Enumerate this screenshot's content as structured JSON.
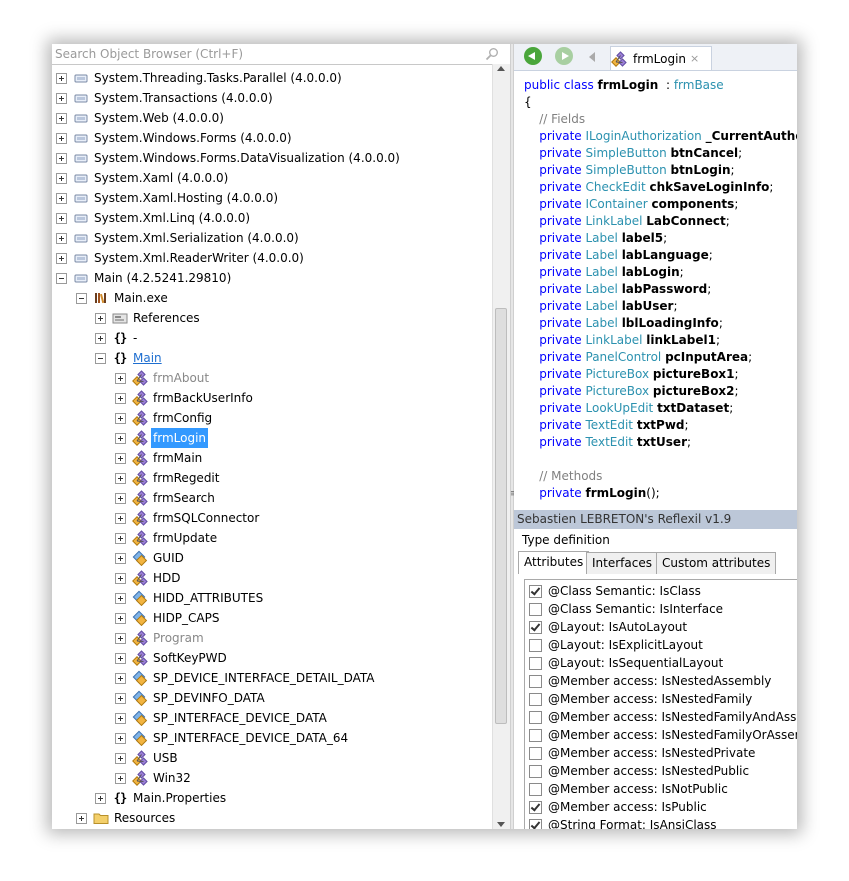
{
  "search": {
    "placeholder": "Search Object Browser (Ctrl+F)"
  },
  "tree": {
    "items": [
      {
        "label": "System.Threading.Tasks.Parallel (4.0.0.0)",
        "icon": "assembly-icon",
        "expander": "plus",
        "level": 0
      },
      {
        "label": "System.Transactions (4.0.0.0)",
        "icon": "assembly-icon",
        "expander": "plus",
        "level": 0
      },
      {
        "label": "System.Web (4.0.0.0)",
        "icon": "assembly-icon",
        "expander": "plus",
        "level": 0
      },
      {
        "label": "System.Windows.Forms (4.0.0.0)",
        "icon": "assembly-icon",
        "expander": "plus",
        "level": 0
      },
      {
        "label": "System.Windows.Forms.DataVisualization (4.0.0.0)",
        "icon": "assembly-icon",
        "expander": "plus",
        "level": 0
      },
      {
        "label": "System.Xaml (4.0.0.0)",
        "icon": "assembly-icon",
        "expander": "plus",
        "level": 0
      },
      {
        "label": "System.Xaml.Hosting (4.0.0.0)",
        "icon": "assembly-icon",
        "expander": "plus",
        "level": 0
      },
      {
        "label": "System.Xml.Linq (4.0.0.0)",
        "icon": "assembly-icon",
        "expander": "plus",
        "level": 0
      },
      {
        "label": "System.Xml.Serialization (4.0.0.0)",
        "icon": "assembly-icon",
        "expander": "plus",
        "level": 0
      },
      {
        "label": "System.Xml.ReaderWriter (4.0.0.0)",
        "icon": "assembly-icon",
        "expander": "plus",
        "level": 0
      },
      {
        "label": "Main (4.2.5241.29810)",
        "icon": "assembly-icon",
        "expander": "minus",
        "level": 0
      },
      {
        "label": "Main.exe",
        "icon": "module-icon",
        "expander": "minus",
        "level": 1
      },
      {
        "label": "References",
        "icon": "references-icon",
        "expander": "plus",
        "level": 2
      },
      {
        "label": "-",
        "icon": "namespace-icon",
        "expander": "plus",
        "level": 2
      },
      {
        "label": "Main",
        "icon": "namespace-icon",
        "expander": "minus",
        "level": 2,
        "style": "link"
      },
      {
        "label": "frmAbout",
        "icon": "class-icon",
        "expander": "plus",
        "level": 3,
        "style": "gray"
      },
      {
        "label": "frmBackUserInfo",
        "icon": "class-icon",
        "expander": "plus",
        "level": 3
      },
      {
        "label": "frmConfig",
        "icon": "class-icon",
        "expander": "plus",
        "level": 3
      },
      {
        "label": "frmLogin",
        "icon": "class-icon",
        "expander": "plus",
        "level": 3,
        "style": "selected"
      },
      {
        "label": "frmMain",
        "icon": "class-icon",
        "expander": "plus",
        "level": 3
      },
      {
        "label": "frmRegedit",
        "icon": "class-icon",
        "expander": "plus",
        "level": 3
      },
      {
        "label": "frmSearch",
        "icon": "class-icon",
        "expander": "plus",
        "level": 3
      },
      {
        "label": "frmSQLConnector",
        "icon": "class-icon",
        "expander": "plus",
        "level": 3
      },
      {
        "label": "frmUpdate",
        "icon": "class-icon",
        "expander": "plus",
        "level": 3
      },
      {
        "label": "GUID",
        "icon": "struct-icon",
        "expander": "plus",
        "level": 3
      },
      {
        "label": "HDD",
        "icon": "class-icon",
        "expander": "plus",
        "level": 3
      },
      {
        "label": "HIDD_ATTRIBUTES",
        "icon": "struct-icon",
        "expander": "plus",
        "level": 3
      },
      {
        "label": "HIDP_CAPS",
        "icon": "struct-icon",
        "expander": "plus",
        "level": 3
      },
      {
        "label": "Program",
        "icon": "class-icon",
        "expander": "plus",
        "level": 3,
        "style": "gray"
      },
      {
        "label": "SoftKeyPWD",
        "icon": "class-icon",
        "expander": "plus",
        "level": 3
      },
      {
        "label": "SP_DEVICE_INTERFACE_DETAIL_DATA",
        "icon": "struct-icon",
        "expander": "plus",
        "level": 3
      },
      {
        "label": "SP_DEVINFO_DATA",
        "icon": "struct-icon",
        "expander": "plus",
        "level": 3
      },
      {
        "label": "SP_INTERFACE_DEVICE_DATA",
        "icon": "struct-icon",
        "expander": "plus",
        "level": 3
      },
      {
        "label": "SP_INTERFACE_DEVICE_DATA_64",
        "icon": "struct-icon",
        "expander": "plus",
        "level": 3
      },
      {
        "label": "USB",
        "icon": "class-icon",
        "expander": "plus",
        "level": 3
      },
      {
        "label": "Win32",
        "icon": "class-icon",
        "expander": "plus",
        "level": 3
      },
      {
        "label": "Main.Properties",
        "icon": "namespace-icon",
        "expander": "plus",
        "level": 2
      },
      {
        "label": "Resources",
        "icon": "folder-icon",
        "expander": "plus",
        "level": 1
      }
    ]
  },
  "editor": {
    "tab_title": "frmLogin",
    "tab_close": "×",
    "code": [
      [
        [
          "kw",
          "public class "
        ],
        [
          "b",
          "frmLogin"
        ],
        [
          "",
          "  : "
        ],
        [
          "ty",
          "frmBase"
        ]
      ],
      [
        [
          "",
          "{"
        ]
      ],
      [
        [
          "cm",
          "    // Fields"
        ]
      ],
      [
        [
          "kw",
          "    private "
        ],
        [
          "ty",
          "ILoginAuthorization "
        ],
        [
          "b",
          "_CurrentAuthorization"
        ]
      ],
      [
        [
          "kw",
          "    private "
        ],
        [
          "ty",
          "SimpleButton "
        ],
        [
          "b",
          "btnCancel"
        ],
        [
          "",
          ";"
        ]
      ],
      [
        [
          "kw",
          "    private "
        ],
        [
          "ty",
          "SimpleButton "
        ],
        [
          "b",
          "btnLogin"
        ],
        [
          "",
          ";"
        ]
      ],
      [
        [
          "kw",
          "    private "
        ],
        [
          "ty",
          "CheckEdit "
        ],
        [
          "b",
          "chkSaveLoginInfo"
        ],
        [
          "",
          ";"
        ]
      ],
      [
        [
          "kw",
          "    private "
        ],
        [
          "ty",
          "IContainer "
        ],
        [
          "b",
          "components"
        ],
        [
          "",
          ";"
        ]
      ],
      [
        [
          "kw",
          "    private "
        ],
        [
          "ty",
          "LinkLabel "
        ],
        [
          "b",
          "LabConnect"
        ],
        [
          "",
          ";"
        ]
      ],
      [
        [
          "kw",
          "    private "
        ],
        [
          "ty",
          "Label "
        ],
        [
          "b",
          "label5"
        ],
        [
          "",
          ";"
        ]
      ],
      [
        [
          "kw",
          "    private "
        ],
        [
          "ty",
          "Label "
        ],
        [
          "b",
          "labLanguage"
        ],
        [
          "",
          ";"
        ]
      ],
      [
        [
          "kw",
          "    private "
        ],
        [
          "ty",
          "Label "
        ],
        [
          "b",
          "labLogin"
        ],
        [
          "",
          ";"
        ]
      ],
      [
        [
          "kw",
          "    private "
        ],
        [
          "ty",
          "Label "
        ],
        [
          "b",
          "labPassword"
        ],
        [
          "",
          ";"
        ]
      ],
      [
        [
          "kw",
          "    private "
        ],
        [
          "ty",
          "Label "
        ],
        [
          "b",
          "labUser"
        ],
        [
          "",
          ";"
        ]
      ],
      [
        [
          "kw",
          "    private "
        ],
        [
          "ty",
          "Label "
        ],
        [
          "b",
          "lblLoadingInfo"
        ],
        [
          "",
          ";"
        ]
      ],
      [
        [
          "kw",
          "    private "
        ],
        [
          "ty",
          "LinkLabel "
        ],
        [
          "b",
          "linkLabel1"
        ],
        [
          "",
          ";"
        ]
      ],
      [
        [
          "kw",
          "    private "
        ],
        [
          "ty",
          "PanelControl "
        ],
        [
          "b",
          "pcInputArea"
        ],
        [
          "",
          ";"
        ]
      ],
      [
        [
          "kw",
          "    private "
        ],
        [
          "ty",
          "PictureBox "
        ],
        [
          "b",
          "pictureBox1"
        ],
        [
          "",
          ";"
        ]
      ],
      [
        [
          "kw",
          "    private "
        ],
        [
          "ty",
          "PictureBox "
        ],
        [
          "b",
          "pictureBox2"
        ],
        [
          "",
          ";"
        ]
      ],
      [
        [
          "kw",
          "    private "
        ],
        [
          "ty",
          "LookUpEdit "
        ],
        [
          "b",
          "txtDataset"
        ],
        [
          "",
          ";"
        ]
      ],
      [
        [
          "kw",
          "    private "
        ],
        [
          "ty",
          "TextEdit "
        ],
        [
          "b",
          "txtPwd"
        ],
        [
          "",
          ";"
        ]
      ],
      [
        [
          "kw",
          "    private "
        ],
        [
          "ty",
          "TextEdit "
        ],
        [
          "b",
          "txtUser"
        ],
        [
          "",
          ";"
        ]
      ],
      [
        [
          "",
          ""
        ]
      ],
      [
        [
          "cm",
          "    // Methods"
        ]
      ],
      [
        [
          "kw",
          "    private "
        ],
        [
          "b",
          "frmLogin"
        ],
        [
          "",
          "();"
        ]
      ]
    ]
  },
  "reflexil": {
    "title": "Sebastien LEBRETON's Reflexil v1.9",
    "type_definition_label": "Type definition",
    "tabs": [
      "Attributes",
      "Interfaces",
      "Custom attributes"
    ],
    "active_tab": 0,
    "attributes": [
      {
        "label": "@Class Semantic: IsClass",
        "checked": true
      },
      {
        "label": "@Class Semantic: IsInterface",
        "checked": false
      },
      {
        "label": "@Layout: IsAutoLayout",
        "checked": true
      },
      {
        "label": "@Layout: IsExplicitLayout",
        "checked": false
      },
      {
        "label": "@Layout: IsSequentialLayout",
        "checked": false
      },
      {
        "label": "@Member access: IsNestedAssembly",
        "checked": false
      },
      {
        "label": "@Member access: IsNestedFamily",
        "checked": false
      },
      {
        "label": "@Member access: IsNestedFamilyAndAssembly",
        "checked": false
      },
      {
        "label": "@Member access: IsNestedFamilyOrAssembly",
        "checked": false
      },
      {
        "label": "@Member access: IsNestedPrivate",
        "checked": false
      },
      {
        "label": "@Member access: IsNestedPublic",
        "checked": false
      },
      {
        "label": "@Member access: IsNotPublic",
        "checked": false
      },
      {
        "label": "@Member access: IsPublic",
        "checked": true
      },
      {
        "label": "@String Format: IsAnsiClass",
        "checked": true
      }
    ]
  }
}
